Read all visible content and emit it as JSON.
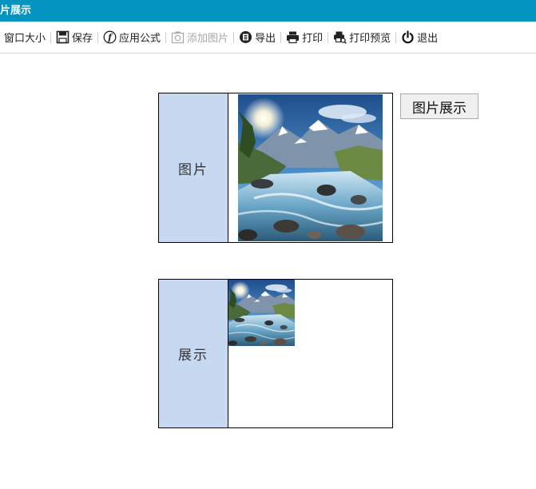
{
  "window": {
    "title": "片展示"
  },
  "toolbar": {
    "items": [
      {
        "label": "窗口大小",
        "icon": "window-size-icon",
        "enabled": true
      },
      {
        "label": "保存",
        "icon": "save-icon",
        "enabled": true
      },
      {
        "label": "应用公式",
        "icon": "formula-icon",
        "enabled": true
      },
      {
        "label": "添加图片",
        "icon": "camera-icon",
        "enabled": false
      },
      {
        "label": "导出",
        "icon": "export-icon",
        "enabled": true
      },
      {
        "label": "打印",
        "icon": "printer-icon",
        "enabled": true
      },
      {
        "label": "打印预览",
        "icon": "print-preview-icon",
        "enabled": true
      },
      {
        "label": "退出",
        "icon": "power-icon",
        "enabled": true
      }
    ]
  },
  "form": {
    "rows": [
      {
        "label": "图片",
        "image": "mountain-river-photo"
      },
      {
        "label": "展示",
        "image": "mountain-river-photo"
      }
    ],
    "show_button_label": "图片展示"
  },
  "colors": {
    "titlebar": "#0494c0",
    "label_cell": "#c6d9f0",
    "toolbar_disabled": "#a8a8a8"
  }
}
